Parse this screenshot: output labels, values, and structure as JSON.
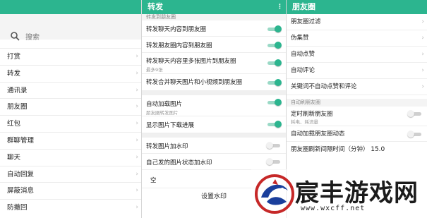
{
  "left": {
    "search_placeholder": "搜索",
    "items": [
      {
        "label": "打赏"
      },
      {
        "label": "转发"
      },
      {
        "label": "通讯录"
      },
      {
        "label": "朋友圈"
      },
      {
        "label": "红包"
      },
      {
        "label": "群聊管理"
      },
      {
        "label": "聊天"
      },
      {
        "label": "自动回复"
      },
      {
        "label": "屏蔽消息"
      },
      {
        "label": "防撤回"
      }
    ]
  },
  "middle": {
    "title": "转发",
    "section1": "转发到朋友圈",
    "rows": [
      {
        "label": "转发聊天内容到朋友圈",
        "sub": "",
        "state": "on"
      },
      {
        "label": "转发朋友圈内容到朋友圈",
        "sub": "",
        "state": "on"
      },
      {
        "label": "转发聊天内容里多张图片到朋友圈",
        "sub": "最多9张",
        "state": "on"
      },
      {
        "label": "转发合并聊天图片和小视频到朋友圈",
        "sub": "",
        "state": "on"
      }
    ],
    "rows2": [
      {
        "label": "自动加载图片",
        "sub": "朋友圈转发图片",
        "state": "on"
      },
      {
        "label": "显示图片下载进展",
        "sub": "",
        "state": "on"
      }
    ],
    "rows3": [
      {
        "label": "转发图片加水印",
        "sub": "",
        "state": "off"
      },
      {
        "label": "自己发的图片状态加水印",
        "sub": "",
        "state": "off"
      }
    ],
    "empty_value": "空",
    "watermark_button": "设置水印"
  },
  "right": {
    "title": "朋友圈",
    "items": [
      {
        "label": "朋友圈过滤"
      },
      {
        "label": "伪集赞"
      },
      {
        "label": "自动点赞"
      },
      {
        "label": "自动评论"
      },
      {
        "label": "关键词不自动点赞和评论"
      }
    ],
    "section2": "自动刷朋友圈",
    "timed_refresh": {
      "label": "定时刷新朋友圈",
      "sub": "耗电、耗流量",
      "state": "off"
    },
    "auto_load": {
      "label": "自动加载朋友圈动态",
      "state": "off"
    },
    "interval_label": "朋友圈刷新间隔时间（分钟）",
    "interval_value": "15.0"
  },
  "watermark": {
    "brand": "宸丰游戏网",
    "url": "www.wxcff.net"
  },
  "colors": {
    "accent": "#2cb58f"
  }
}
